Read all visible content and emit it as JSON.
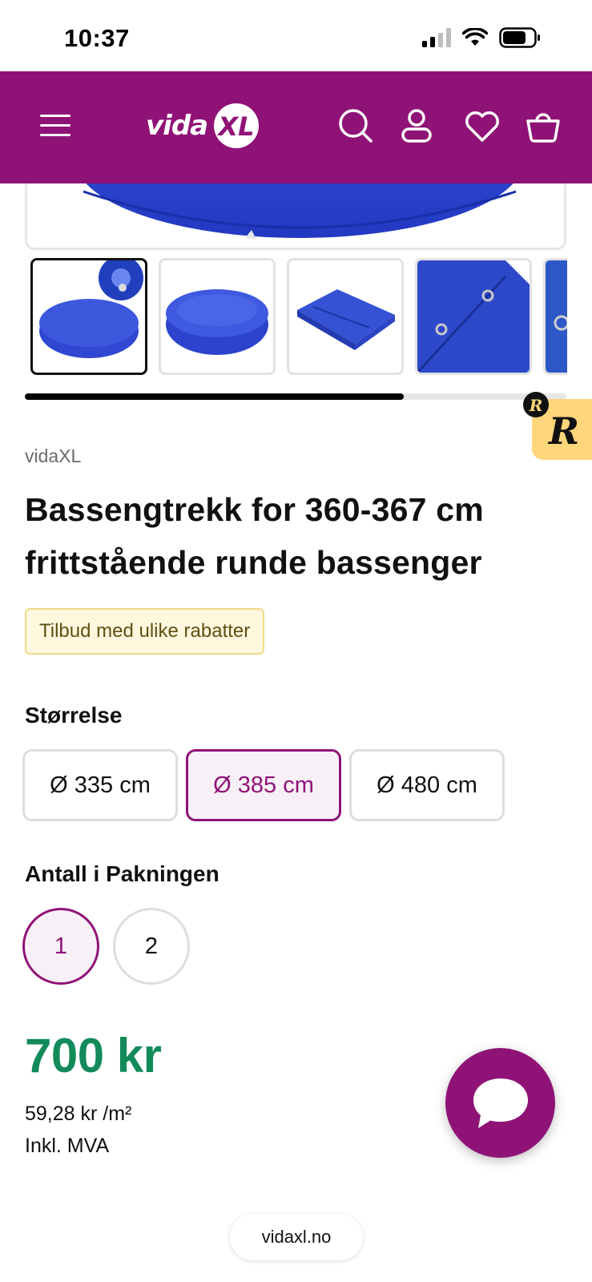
{
  "status_bar": {
    "time": "10:37"
  },
  "header": {
    "logo_text": "vida",
    "logo_mark": "XL",
    "menu_icon": "hamburger-menu-icon",
    "search_icon": "search-icon",
    "account_icon": "user-icon",
    "wishlist_icon": "heart-icon",
    "cart_icon": "shopping-basket-icon",
    "brand_color": "#8f1377"
  },
  "gallery": {
    "thumbnail_count": 5,
    "active_index": 0,
    "scroll_progress": 0.7
  },
  "product": {
    "brand": "vidaXL",
    "title": "Bassengtrekk for 360-367 cm frittstående runde bassenger",
    "promo_badge": "Tilbud med ulike rabatter"
  },
  "size": {
    "label": "Størrelse",
    "options": [
      {
        "label": "Ø 335 cm",
        "selected": false
      },
      {
        "label": "Ø 385 cm",
        "selected": true
      },
      {
        "label": "Ø 480 cm",
        "selected": false
      }
    ]
  },
  "pack": {
    "label": "Antall i Pakningen",
    "options": [
      {
        "label": "1",
        "selected": true
      },
      {
        "label": "2",
        "selected": false
      }
    ]
  },
  "pricing": {
    "price": "700 kr",
    "unit_price": "59,28 kr /m²",
    "vat_note": "Inkl. MVA",
    "price_color": "#138a5a"
  },
  "chat": {
    "icon": "chat-bubble-icon"
  },
  "browser": {
    "url": "vidaxl.no"
  }
}
